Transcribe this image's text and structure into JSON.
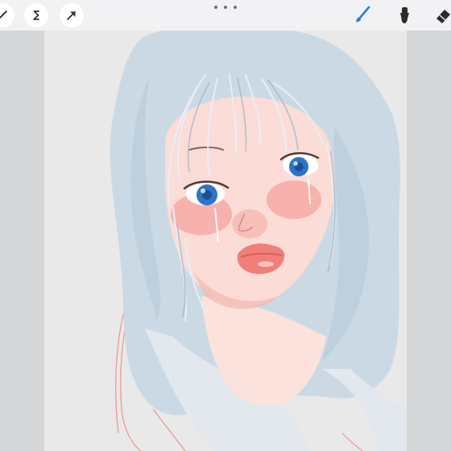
{
  "app": {
    "toolbar": {
      "left_tools": [
        {
          "name": "adjustments",
          "icon": "magic-wand-icon"
        },
        {
          "name": "selection",
          "icon": "selection-s-icon"
        },
        {
          "name": "transform",
          "icon": "arrow-cursor-icon"
        }
      ],
      "right_tools": [
        {
          "name": "brush",
          "icon": "brush-icon",
          "active": true,
          "color": "#2f78e6"
        },
        {
          "name": "smudge",
          "icon": "smudge-icon",
          "active": false
        },
        {
          "name": "eraser",
          "icon": "eraser-icon",
          "active": false
        }
      ],
      "grabber_icon": "more-dots-icon"
    },
    "canvas": {
      "artwork_palette": {
        "hair": "#c9d8e4",
        "skin": "#fbdcd6",
        "blush": "#f6a8a2",
        "eyes": "#2f73c9",
        "lips": "#f07f77",
        "sketch_lines": "#ef8a80",
        "background": "#e9e9ea"
      }
    }
  }
}
